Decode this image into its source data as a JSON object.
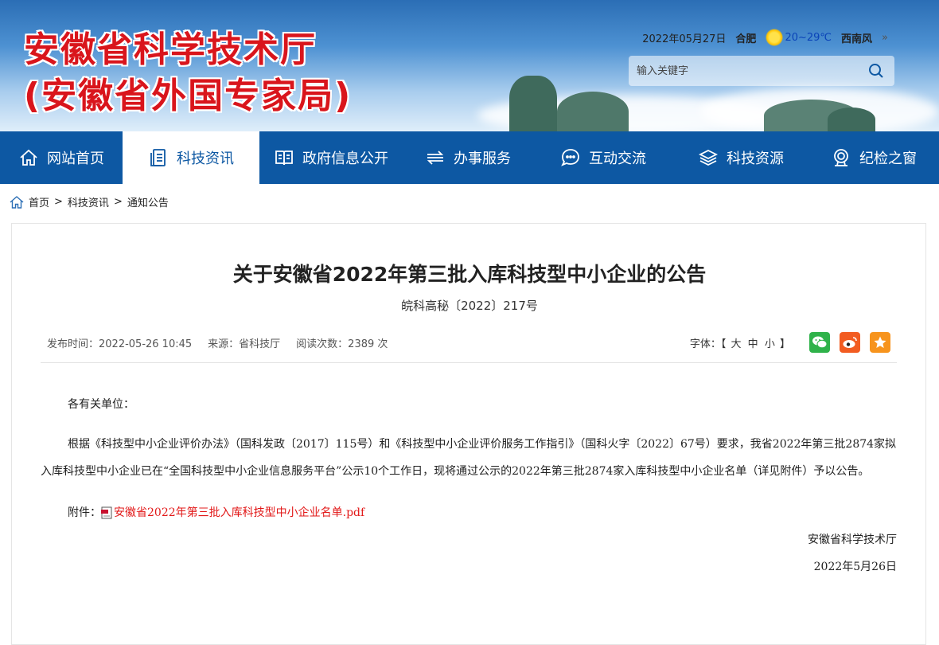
{
  "header": {
    "title_line1": "安徽省科学技术厅",
    "title_line2": "(安徽省外国专家局)",
    "date": "2022年05月27日",
    "city": "合肥",
    "temperature": "20~29℃",
    "wind": "西南风",
    "wind_more": "»",
    "search_placeholder": "输入关键字"
  },
  "nav": {
    "items": [
      {
        "label": "网站首页",
        "icon": "home-icon"
      },
      {
        "label": "科技资讯",
        "icon": "news-icon"
      },
      {
        "label": "政府信息公开",
        "icon": "book-icon"
      },
      {
        "label": "办事服务",
        "icon": "service-icon"
      },
      {
        "label": "互动交流",
        "icon": "chat-icon"
      },
      {
        "label": "科技资源",
        "icon": "resource-icon"
      },
      {
        "label": "纪检之窗",
        "icon": "shield-icon"
      }
    ],
    "active_index": 1
  },
  "breadcrumb": {
    "home": "首页",
    "sep1": ">",
    "level1": "科技资讯",
    "sep2": ">",
    "level2": "通知公告"
  },
  "article": {
    "title": "关于安徽省2022年第三批入库科技型中小企业的公告",
    "doc_number": "皖科高秘〔2022〕217号",
    "meta": {
      "publish_time": "发布时间：2022-05-26 10:45",
      "source": "来源：省科技厅",
      "read_count": "阅读次数：2389 次"
    },
    "font_label": "字体：【",
    "font_sizes": [
      "大",
      "中",
      "小"
    ],
    "font_end": "】",
    "greeting": "各有关单位：",
    "body": "根据《科技型中小企业评价办法》（国科发政〔2017〕115号）和《科技型中小企业评价服务工作指引》（国科火字〔2022〕67号）要求，我省2022年第三批2874家拟入库科技型中小企业已在“全国科技型中小企业信息服务平台”公示10个工作日，现将通过公示的2022年第三批2874家入库科技型中小企业名单（详见附件）予以公告。",
    "attachment_label": "附件：",
    "attachment_name": "安徽省2022年第三批入库科技型中小企业名单.pdf",
    "signature": "安徽省科学技术厅",
    "sign_date": "2022年5月26日"
  },
  "colors": {
    "brand_blue": "#0d58a3",
    "title_red": "#d9151c",
    "wechat_green": "#2fb24a",
    "weibo_orange": "#f25c21",
    "favorite_orange": "#f7941d",
    "link_red": "#e21818"
  }
}
